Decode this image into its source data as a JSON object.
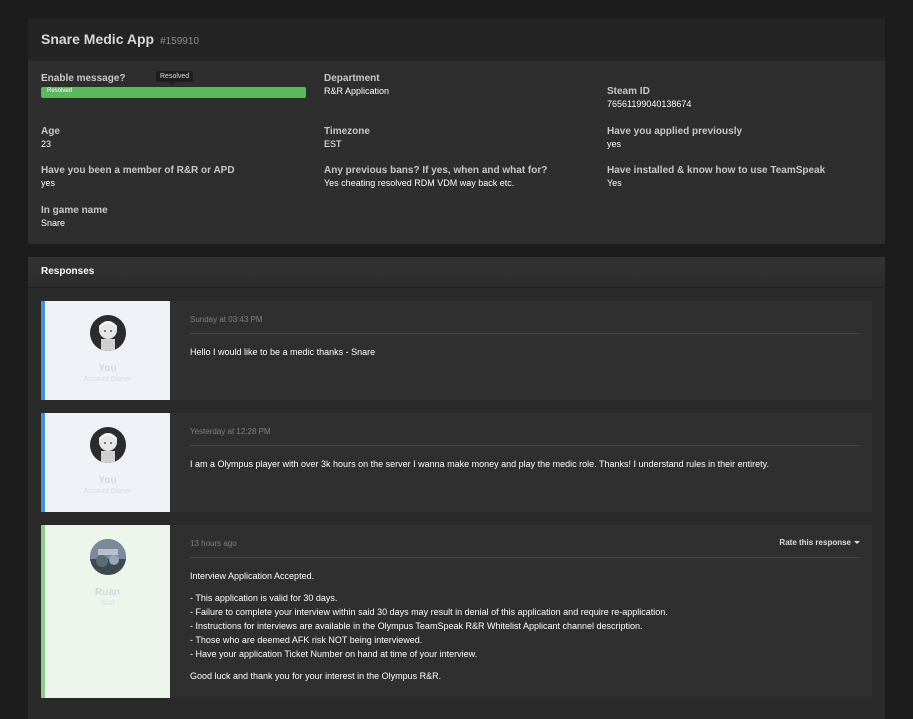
{
  "application": {
    "title": "Snare Medic App",
    "id": "#159910",
    "status": {
      "label": "Enable message?",
      "progress_text": "Resolved",
      "tooltip": "Resolved",
      "progress_percent": 100
    },
    "fields": {
      "department": {
        "label": "Department",
        "value": "R&R Application"
      },
      "steam_id": {
        "label": "Steam ID",
        "value": "76561199040138674"
      },
      "age": {
        "label": "Age",
        "value": "23"
      },
      "timezone": {
        "label": "Timezone",
        "value": "EST"
      },
      "applied_previously": {
        "label": "Have you applied previously",
        "value": "yes"
      },
      "member": {
        "label": "Have you been a member of R&R or APD",
        "value": "yes"
      },
      "bans": {
        "label": "Any previous bans? If yes, when and what for?",
        "value": "Yes cheating resolved RDM VDM way back etc."
      },
      "teamspeak": {
        "label": "Have installed & know how to use TeamSpeak",
        "value": "Yes"
      },
      "ingame_name": {
        "label": "In game name",
        "value": "Snare"
      }
    }
  },
  "responses": {
    "title": "Responses",
    "items": [
      {
        "name": "You",
        "role": "Account Owner",
        "time": "Sunday at 03:43 PM",
        "text": [
          "Hello I would like to be a medic thanks - Snare"
        ]
      },
      {
        "name": "You",
        "role": "Account Owner",
        "time": "Yesterday at 12:28 PM",
        "text": [
          "I am a Olympus player with over 3k hours on the server I wanna make money and play the medic role. Thanks! I understand rules in their entirety."
        ]
      },
      {
        "name": "Ruan",
        "role": "Staff",
        "time": "13 hours ago",
        "rate_label": "Rate this response",
        "text": [
          "Interview Application Accepted.",
          "- This application is valid for 30 days.",
          "- Failure to complete your interview within said 30 days may result in denial of this application and require re-application.",
          "- Instructions for interviews are available in the Olympus TeamSpeak R&R Whitelist Applicant channel description.",
          "- Those who are deemed AFK risk NOT being interviewed.",
          "- Have your application Ticket Number on hand at time of your interview.",
          "Good luck and thank you for your interest in the Olympus R&R."
        ]
      }
    ]
  },
  "colors": {
    "progress": "#5cb85c",
    "owner_accent": "#4a90d9",
    "staff_accent": "#8ccc8c"
  }
}
